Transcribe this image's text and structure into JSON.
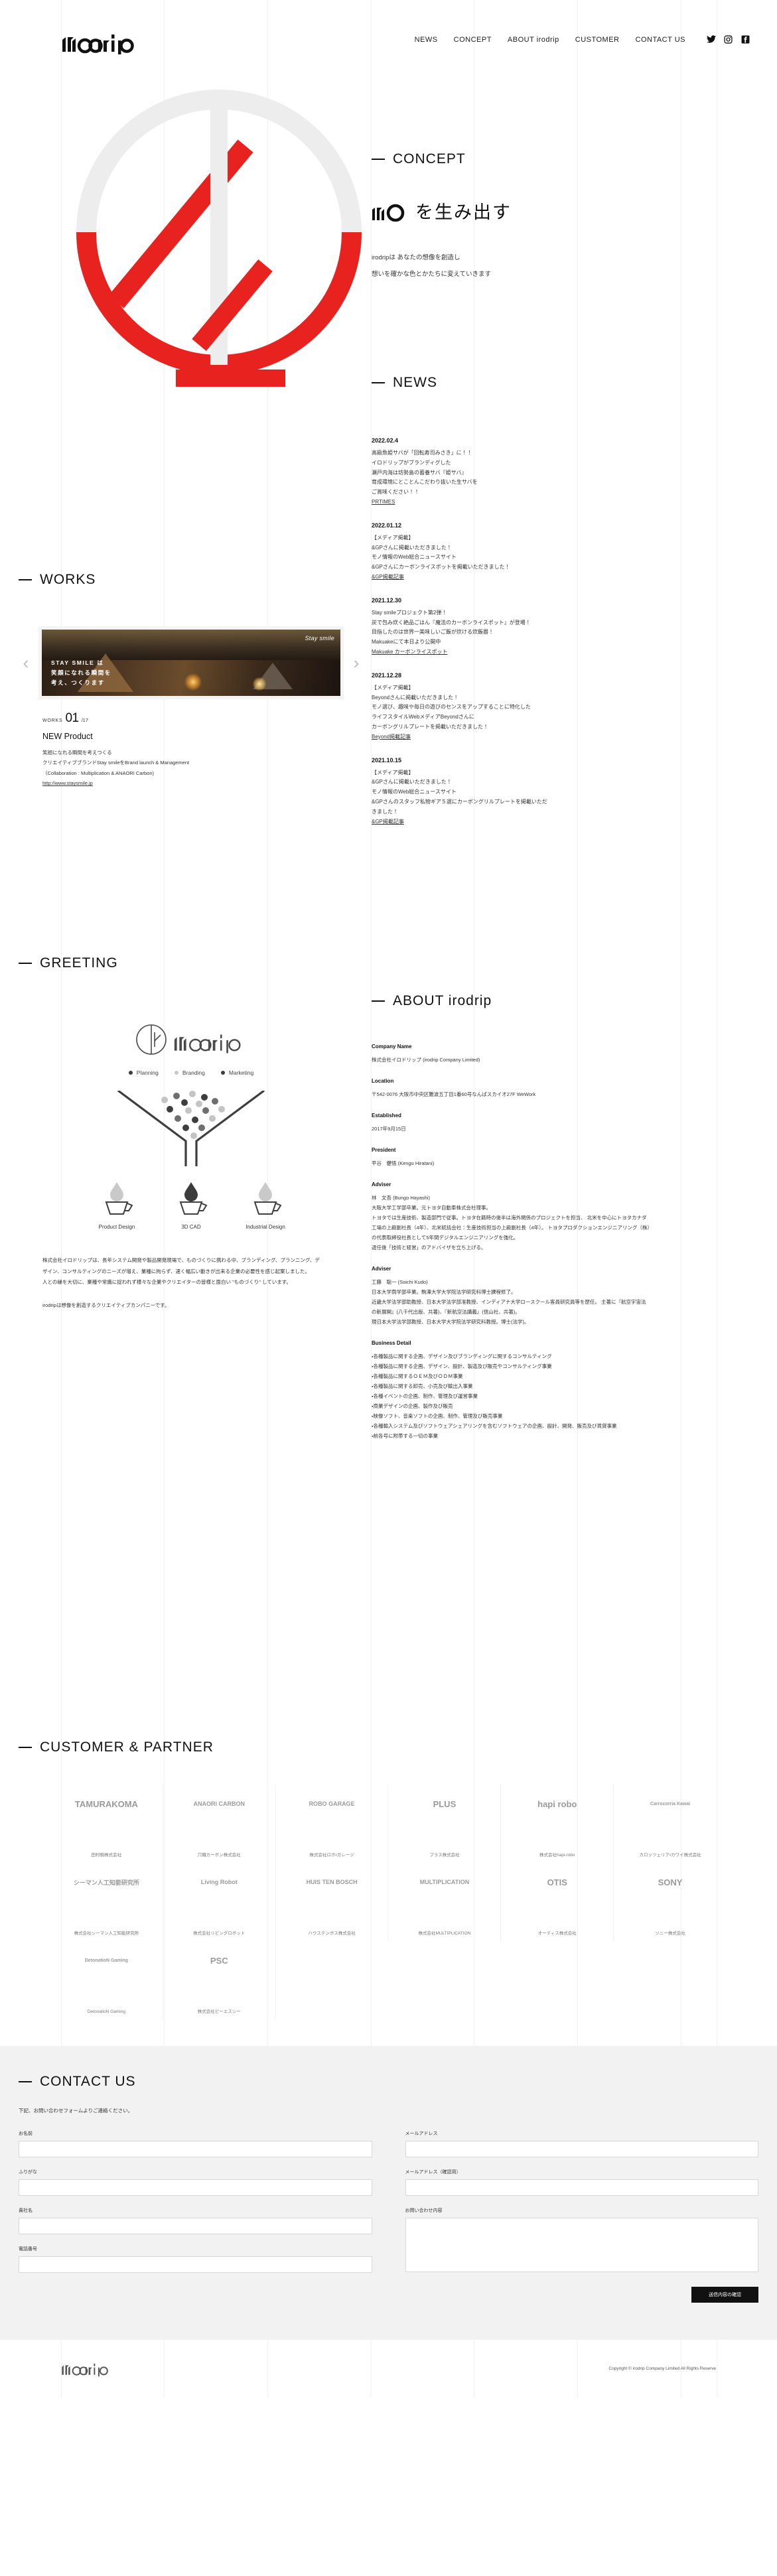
{
  "site": {
    "brand": "irodrip"
  },
  "header": {
    "nav": [
      {
        "label": "NEWS"
      },
      {
        "label": "CONCEPT"
      },
      {
        "label": "ABOUT irodrip"
      },
      {
        "label": "CUSTOMER"
      },
      {
        "label": "CONTACT US"
      }
    ],
    "social": [
      {
        "name": "twitter-icon"
      },
      {
        "name": "instagram-icon"
      },
      {
        "name": "facebook-icon"
      }
    ]
  },
  "concept": {
    "label": "CONCEPT",
    "headline_suffix": "を生み出す",
    "body_line1": "irodripは あなたの想像を創造し",
    "body_line2": "想いを確かな色とかたちに変えていきます"
  },
  "news": {
    "label": "NEWS",
    "items": [
      {
        "date": "2022.02.4",
        "lines": [
          "高級魚姫サバが「回転寿司みさき」に！！",
          "イロドリップがブランディグした",
          "瀬戸内海は坊勢島の蓄養サバ『姫サバ』",
          "育成環境にとことんこだわり抜いた生サバを",
          "ご賞味ください！！"
        ],
        "link": "PRTIMES"
      },
      {
        "date": "2022.01.12",
        "lines": [
          "【メディア掲載】",
          "&GPさんに掲載いただきました！",
          "モノ情報のWeb総合ニュースサイト",
          "&GPさんにカーボンライスポットを掲載いただきました！"
        ],
        "link": "&GP掲載記事"
      },
      {
        "date": "2021.12.30",
        "lines": [
          "Stay smileプロジェクト第2弾！",
          "炭で包み炊く絶品ごはん『魔法のカーボンライスポット』が登場！",
          "目指したのは世界一美味しいご飯が炊ける炊飯器！",
          "Makuakeにて本日より公開中"
        ],
        "link": "Makuake カーボンライスポット"
      },
      {
        "date": "2021.12.28",
        "lines": [
          "【メディア掲載】",
          "Beyondさんに掲載いただきました！",
          "モノ選び、趣味や毎日の遊びのセンスをアップすることに特化した",
          "ライフスタイルWebメディアBeyondさんに",
          "カーボングリルプレートを掲載いただきました！"
        ],
        "link": "Beyond掲載記事"
      },
      {
        "date": "2021.10.15",
        "lines": [
          "【メディア掲載】",
          "&GPさんに掲載いただきました！",
          "モノ情報のWeb総合ニュースサイト",
          "&GPさんのスタッフ私物ギア５選にカーボングリルプレートを掲載いただ",
          "きました！"
        ],
        "link": "&GP掲載記事"
      }
    ]
  },
  "works": {
    "label": "WORKS",
    "prev_icon": "chevron-left-icon",
    "next_icon": "chevron-right-icon",
    "slide": {
      "brand": "Stay smile",
      "copy_line1": "STAY SMILE は",
      "copy_line2": "笑顔になれる瞬間を",
      "copy_line3": "考え、つくります"
    },
    "kicker": "WORKS",
    "number": "01",
    "total": "/17",
    "title": "NEW Product",
    "desc": [
      "笑顔になれる瞬間を考えつくる",
      "クリエイティブブランドStay smileをBrand launch & Management",
      "（Collaboration : Multiplication & ANAORI Carbon)"
    ],
    "url": "http://www.staysmile.jp"
  },
  "greeting": {
    "label": "GREETING",
    "logo_text": "irodrip",
    "tags": [
      {
        "label": "Planning",
        "color": "#3c3c3c"
      },
      {
        "label": "Branding",
        "color": "#c9c9c9"
      },
      {
        "label": "Marketing",
        "color": "#3c3c3c"
      }
    ],
    "icons": [
      {
        "caption": "Product Design",
        "drop_color": "#c9c9c9"
      },
      {
        "caption": "3D CAD",
        "drop_color": "#3c3c3c"
      },
      {
        "caption": "Industrial Design",
        "drop_color": "#c9c9c9"
      }
    ],
    "paragraph1": "株式会社イロドリップは、長年システム開発や製品開発現場で、ものづくりに携わる中、ブランディング、プランニング、デザイン、コンサルティングのニーズが増え、業種に拘らず、速く幅広い動きが出来る企業の必要性を感じ起案しました。",
    "paragraph2": "人との縁を大切に、業種や常識に捉われず様々な企業やクリエイターの皆様と面白い \"ものづくり\" しています。",
    "paragraph3": "irodripは想像を創造するクリエイティブカンパニーです。"
  },
  "about": {
    "label": "ABOUT irodrip",
    "blocks": [
      {
        "heading": "Company Name",
        "text": "株式会社イロドリップ (irodrip Company Limited)"
      },
      {
        "heading": "Location",
        "text": "〒542-0076 大阪市中央区難波五丁目1番60号なんばスカイオ27F WeWork"
      },
      {
        "heading": "Established",
        "text": "2017年9月15日"
      },
      {
        "heading": "President",
        "text": "平谷　健悟 (Kengo Hiratani)"
      },
      {
        "heading": "Adviser",
        "text": "林　文吾 (Bungo Hayashi)\n大阪大学工学部卒業。元トヨタ自動車株式会社理事。\nトヨタでは生産技術、製造部門で従事。トヨタ在籍時の後半は海外関係のプロジェクトを担当、 北米を中心にトヨタカナダ工場の上級副社長（4年）、北米統括会社：生産技術担当の上級副社長（4年）。 トヨタプロダクションエンジニアリング（株）の代表取締役社長として5年間デジタルエンジニアリングを強化。\n退任後「技術と経営」のアドバイザを立ち上げる。"
      },
      {
        "heading": "Adviser",
        "text": "工藤　聡一 (Soichi Kudo)\n日本大学商学部卒業。駒澤大学大学院法学研究科博士課程修了。\n近畿大学法学部助教授、日本大学法学部准教授、インディアナ大学ロースクール客員研究員等を歴任。 主著に『航空宇宙法の新展開』(八千代出版、共著)、『新航空法講義』(信山社、共著)。\n現日本大学法学部教授、日本大学大学院法学研究科教授。博士(法学)。"
      }
    ],
    "business_heading": "Business Detail",
    "business_items": [
      "・各種製品に関する企画、デザイン及びブランディングに関するコンサルティング",
      "・各種製品に関する企画、デザイン、設計、製造及び販売やコンサルティング事業",
      "・各種製品に関するＯＥＭ及びＯＤＭ事業",
      "・各種製品に関する卸売、小売及び輸出入事業",
      "・各種イベントの企画、制作、管理及び運営事業",
      "・商業デザインの企画、製作及び販売",
      "・映像ソフト、音楽ソフトの企画、制作、管理及び販売事業",
      "・各種輸入システム及びソフトウェアシェアリングを含むソフトウェアの企画、設計、開発、販売及び賃貸事業",
      "・前各号に附帯する一切の事業"
    ]
  },
  "customer": {
    "label": "CUSTOMER & PARTNER",
    "logos": [
      {
        "mark": "TAMURAKOMA",
        "caption": "田村駒株式会社"
      },
      {
        "mark": "ANAORi CARBON",
        "caption": "穴織カーボン株式会社"
      },
      {
        "mark": "ROBO GARAGE",
        "caption": "株式会社ロボ・ガレージ"
      },
      {
        "mark": "PLUS",
        "caption": "プラス株式会社"
      },
      {
        "mark": "hapi robo",
        "caption": "株式会社hapi-robo"
      },
      {
        "mark": "Carrozzeria Kawai",
        "caption": "カロッツェリア・カワイ株式会社"
      },
      {
        "mark": "シーマン人工知能研究所",
        "caption": "株式会社シーマン人工知能研究所"
      },
      {
        "mark": "Living Robot",
        "caption": "株式会社リビングロボット"
      },
      {
        "mark": "HUIS TEN BOSCH",
        "caption": "ハウステンボス株式会社"
      },
      {
        "mark": "MULTIPLICATION",
        "caption": "株式会社MULTIPLICATION"
      },
      {
        "mark": "OTIS",
        "caption": "オーティス株式会社"
      },
      {
        "mark": "SONY",
        "caption": "ソニー株式会社"
      },
      {
        "mark": "DetonatioN Gaming",
        "caption": "DetonatioN Gaming"
      },
      {
        "mark": "PSC",
        "caption": "株式会社ピーエスシー"
      }
    ]
  },
  "contact": {
    "label": "CONTACT US",
    "lead": "下記、お問い合わせフォームよりご連絡ください。",
    "fields": [
      {
        "name": "お名前",
        "type": "text",
        "value": ""
      },
      {
        "name": "メールアドレス",
        "type": "text",
        "value": ""
      },
      {
        "name": "ふりがな",
        "type": "text",
        "value": ""
      },
      {
        "name": "メールアドレス（確認用）",
        "type": "text",
        "value": ""
      },
      {
        "name": "貴社名",
        "type": "text",
        "value": ""
      },
      {
        "name": "お問い合わせ内容",
        "type": "textarea",
        "value": ""
      },
      {
        "name": "電話番号",
        "type": "text",
        "value": ""
      }
    ],
    "submit_label": "送信内容の確認"
  },
  "footer": {
    "logo_text": "irodrip",
    "copyright": "Copyright © irodrip Company Limited All Rights Reserve"
  }
}
